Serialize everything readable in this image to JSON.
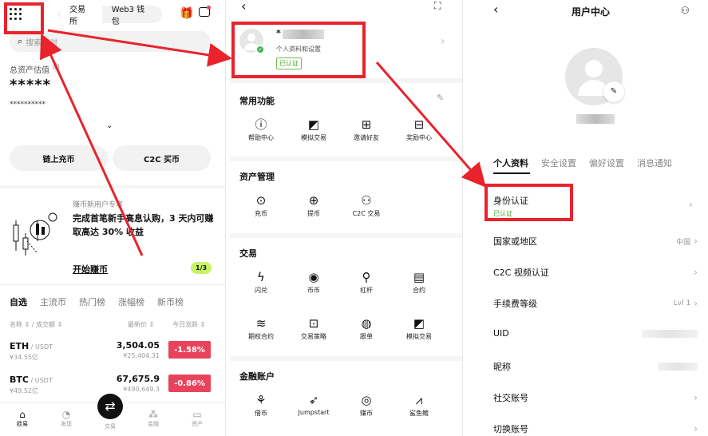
{
  "panel1": {
    "seg": [
      "交易所",
      "Web3 钱包"
    ],
    "search_placeholder": "搜索币对",
    "asset_label": "总资产估值",
    "asset_value": "*****",
    "asset_sub": "**********",
    "btn_onchain": "链上充币",
    "btn_c2c": "C2C 买币",
    "promo_tag": "赚币新用户专享",
    "promo_text": "完成首笔新手高息认购，3 天内可赚取高达 30% 收益",
    "promo_action": "开始赚币",
    "promo_page": "1/3",
    "market_tabs": [
      "自选",
      "主流币",
      "热门榜",
      "涨幅榜",
      "新币榜"
    ],
    "col_name": "名称 ⇕ / 成交额 ⇕",
    "col_price": "最新价 ⇕",
    "col_change": "今日涨跌 ⇕",
    "rows": [
      {
        "coin": "ETH",
        "quote": " / USDT",
        "vol": "¥34.55亿",
        "price": "3,504.05",
        "cny": "¥25,404.31",
        "change": "-1.58%"
      },
      {
        "coin": "BTC",
        "quote": " / USDT",
        "vol": "¥49.52亿",
        "price": "67,675.9",
        "cny": "¥490,649.3",
        "change": "-0.86%"
      }
    ],
    "nav": [
      "欧易",
      "发现",
      "交易",
      "金融",
      "资产"
    ]
  },
  "panel2": {
    "profile_name": "*",
    "profile_sub": "个人资料和设置",
    "verified": "已认证",
    "sections": [
      {
        "title": "常用功能",
        "items": [
          "帮助中心",
          "模拟交易",
          "邀请好友",
          "奖励中心"
        ]
      },
      {
        "title": "资产管理",
        "items": [
          "充币",
          "提币",
          "C2C 交易"
        ]
      },
      {
        "title": "交易",
        "items": [
          "闪兑",
          "币币",
          "杠杆",
          "合约",
          "期权合约",
          "交易策略",
          "跟单",
          "模拟交易"
        ]
      },
      {
        "title": "金融账户",
        "items": [
          "借币",
          "Jumpstart",
          "赚币",
          "鲨鱼鳍"
        ]
      }
    ]
  },
  "panel3": {
    "title": "用户中心",
    "tabs": [
      "个人资料",
      "安全设置",
      "偏好设置",
      "消息通知"
    ],
    "id_label": "身份认证",
    "id_status": "已认证",
    "rows": [
      {
        "label": "国家或地区",
        "value": "中国"
      },
      {
        "label": "C2C 视频认证",
        "value": ""
      },
      {
        "label": "手续费等级",
        "value": "Lvl 1"
      },
      {
        "label": "UID",
        "value": ""
      },
      {
        "label": "昵称",
        "value": ""
      },
      {
        "label": "社交账号",
        "value": ""
      },
      {
        "label": "切换账号",
        "value": ""
      }
    ]
  },
  "colors": {
    "annotation_red": "#e8232c",
    "down_red": "#e9435b",
    "verified_green": "#4aa52a"
  }
}
